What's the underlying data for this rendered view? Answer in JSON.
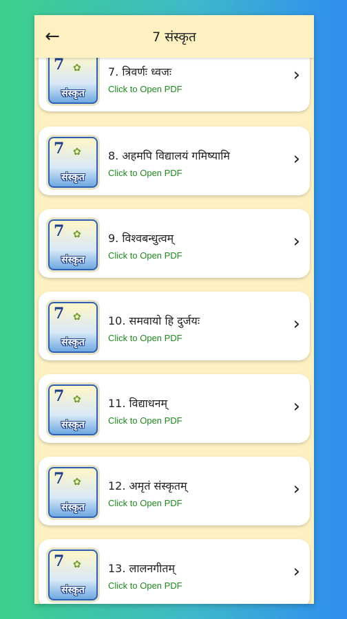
{
  "app": {
    "title": "7 संस्कृत",
    "back_icon": "arrow-left-icon"
  },
  "thumbnail": {
    "number": "7",
    "word": "संस्कृत"
  },
  "items": [
    {
      "title": "7. त्रिवर्णः ध्वजः",
      "subtitle": "Click to Open PDF"
    },
    {
      "title": "8. अहमपि विद्यालयं गमिष्यामि",
      "subtitle": "Click to Open PDF"
    },
    {
      "title": "9. विश्वबन्धुत्वम्",
      "subtitle": "Click to Open PDF"
    },
    {
      "title": "10. समवायो हि दुर्जयः",
      "subtitle": "Click to Open PDF"
    },
    {
      "title": "11. विद्याधनम्",
      "subtitle": "Click to Open PDF"
    },
    {
      "title": "12. अमृतं संस्कृतम्",
      "subtitle": "Click to Open PDF"
    },
    {
      "title": "13. लालनगीतम्",
      "subtitle": "Click to Open PDF"
    }
  ],
  "colors": {
    "background_left": "#3ed08a",
    "background_right": "#2f8ef0",
    "card": "#ffffff",
    "subtitle": "#1a8a1a",
    "page": "#fdf1c2"
  }
}
